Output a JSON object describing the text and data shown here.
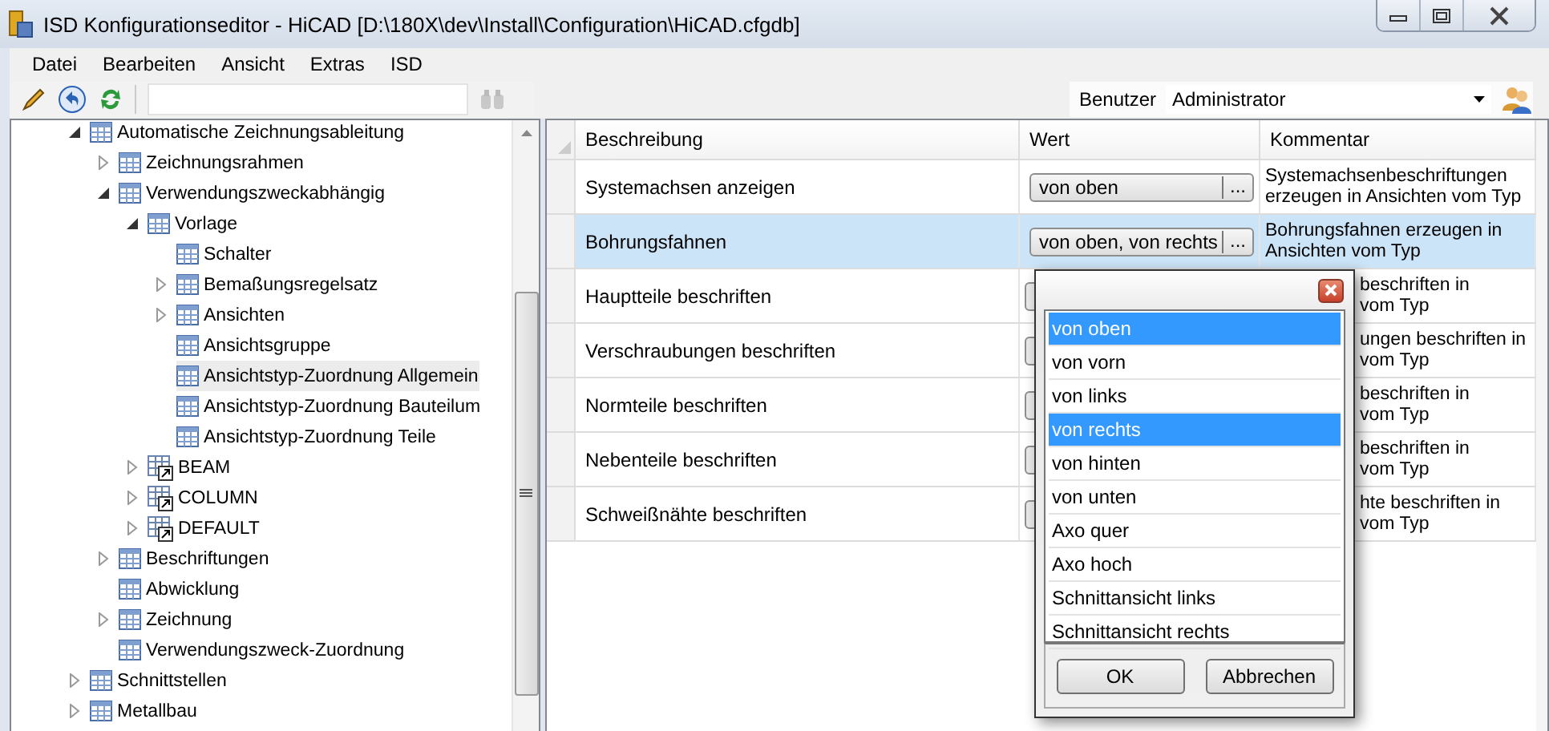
{
  "window": {
    "title": "ISD Konfigurationseditor  - HiCAD [D:\\180X\\dev\\Install\\Configuration\\HiCAD.cfgdb]"
  },
  "menu": [
    "Datei",
    "Bearbeiten",
    "Ansicht",
    "Extras",
    "ISD"
  ],
  "user": {
    "label": "Benutzer",
    "value": "Administrator"
  },
  "tree": [
    {
      "label": "Automatische Zeichnungsableitung",
      "kind": "table",
      "expanded": true,
      "selected": false,
      "children": [
        {
          "label": "Zeichnungsrahmen",
          "kind": "table",
          "expanded": false,
          "selected": false
        },
        {
          "label": "Verwendungszweckabhängig",
          "kind": "table",
          "expanded": true,
          "selected": false,
          "children": [
            {
              "label": "Vorlage",
              "kind": "table",
              "expanded": true,
              "selected": false,
              "children": [
                {
                  "label": "Schalter",
                  "kind": "table",
                  "selected": false
                },
                {
                  "label": "Bemaßungsregelsatz",
                  "kind": "table",
                  "expanded": false,
                  "selected": false
                },
                {
                  "label": "Ansichten",
                  "kind": "table",
                  "expanded": false,
                  "selected": false
                },
                {
                  "label": "Ansichtsgruppe",
                  "kind": "table",
                  "selected": false
                },
                {
                  "label": "Ansichtstyp-Zuordnung Allgemein",
                  "kind": "table",
                  "selected": true
                },
                {
                  "label": "Ansichtstyp-Zuordnung Bauteilum",
                  "kind": "table",
                  "selected": false
                },
                {
                  "label": "Ansichtstyp-Zuordnung Teile",
                  "kind": "table",
                  "selected": false
                }
              ]
            },
            {
              "label": "BEAM",
              "kind": "link",
              "expanded": false,
              "selected": false
            },
            {
              "label": "COLUMN",
              "kind": "link",
              "expanded": false,
              "selected": false
            },
            {
              "label": "DEFAULT",
              "kind": "link",
              "expanded": false,
              "selected": false
            }
          ]
        },
        {
          "label": "Beschriftungen",
          "kind": "table",
          "expanded": false,
          "selected": false
        },
        {
          "label": "Abwicklung",
          "kind": "table",
          "selected": false
        },
        {
          "label": "Zeichnung",
          "kind": "table",
          "expanded": false,
          "selected": false
        },
        {
          "label": "Verwendungszweck-Zuordnung",
          "kind": "table",
          "selected": false
        }
      ]
    },
    {
      "label": "Schnittstellen",
      "kind": "table",
      "expanded": false,
      "selected": false
    },
    {
      "label": "Metallbau",
      "kind": "table",
      "expanded": false,
      "selected": false
    }
  ],
  "grid": {
    "columns": [
      "Beschreibung",
      "Wert",
      "Kommentar"
    ],
    "rows": [
      {
        "description": "Systemachsen anzeigen",
        "value": "von oben",
        "browse": "...",
        "comment": "Systemachsenbeschriftungen erzeugen in Ansichten vom Typ",
        "comment_covered": false,
        "selected": false
      },
      {
        "description": "Bohrungsfahnen",
        "value": "von oben, von rechts",
        "browse": "...",
        "comment": "Bohrungsfahnen erzeugen in Ansichten vom Typ",
        "comment_covered": false,
        "selected": true
      },
      {
        "description": "Hauptteile beschriften",
        "comment": "beschriften in\nvom Typ",
        "comment_covered": true,
        "selected": false
      },
      {
        "description": "Verschraubungen beschriften",
        "comment": "ungen beschriften in\nvom Typ",
        "comment_covered": true,
        "selected": false
      },
      {
        "description": "Normteile beschriften",
        "comment": "beschriften in\nvom Typ",
        "comment_covered": true,
        "selected": false
      },
      {
        "description": "Nebenteile beschriften",
        "comment": "beschriften in\nvom Typ",
        "comment_covered": true,
        "selected": false
      },
      {
        "description": "Schweißnähte beschriften",
        "comment": "hte beschriften in\nvom Typ",
        "comment_covered": true,
        "selected": false
      }
    ]
  },
  "popup": {
    "items": [
      {
        "label": "von oben",
        "selected": true
      },
      {
        "label": "von vorn",
        "selected": false
      },
      {
        "label": "von links",
        "selected": false
      },
      {
        "label": "von rechts",
        "selected": true
      },
      {
        "label": "von hinten",
        "selected": false
      },
      {
        "label": "von unten",
        "selected": false
      },
      {
        "label": "Axo quer",
        "selected": false
      },
      {
        "label": "Axo hoch",
        "selected": false
      },
      {
        "label": "Schnittansicht links",
        "selected": false
      },
      {
        "label": "Schnittansicht rechts",
        "selected": false
      }
    ],
    "buttons": [
      "OK",
      "Abbrechen"
    ]
  }
}
